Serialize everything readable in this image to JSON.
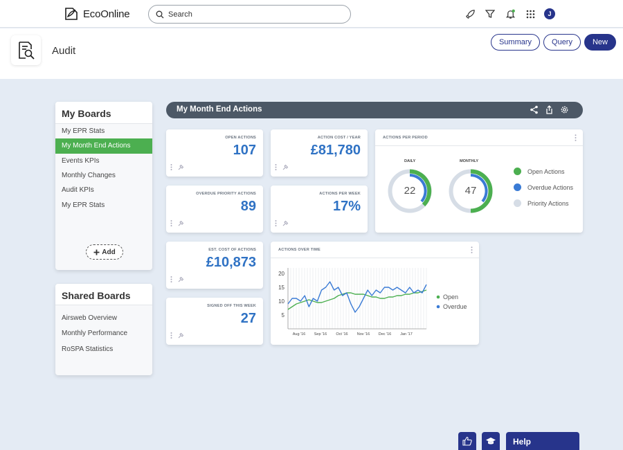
{
  "app": {
    "brand": "EcoOnline"
  },
  "search": {
    "placeholder": "Search"
  },
  "user": {
    "initial": "J"
  },
  "page": {
    "title": "Audit"
  },
  "header_buttons": {
    "summary": "Summary",
    "query": "Query",
    "new": "New"
  },
  "my_boards": {
    "title": "My Boards",
    "items": [
      {
        "label": "My EPR Stats",
        "active": false
      },
      {
        "label": "My Month End Actions",
        "active": true
      },
      {
        "label": "Events KPIs",
        "active": false
      },
      {
        "label": "Monthly Changes",
        "active": false
      },
      {
        "label": "Audit KPIs",
        "active": false
      },
      {
        "label": "My EPR Stats",
        "active": false
      }
    ],
    "add_label": "Add"
  },
  "shared_boards": {
    "title": "Shared Boards",
    "items": [
      {
        "label": "Airsweb Overview"
      },
      {
        "label": "Monthly Performance"
      },
      {
        "label": "RoSPA Statistics"
      }
    ]
  },
  "dashboard": {
    "title": "My Month End Actions"
  },
  "tiles": [
    {
      "label": "Open Actions",
      "value": "107"
    },
    {
      "label": "Action Cost / Year",
      "value": "£81,780"
    },
    {
      "label": "Overdue Priority Actions",
      "value": "89"
    },
    {
      "label": "Actions Per Week",
      "value": "17%"
    },
    {
      "label": "Est. Cost of Actions",
      "value": "£10,873"
    },
    {
      "label": "Signed Off This Week",
      "value": "27"
    }
  ],
  "actions_per_period": {
    "title": "Actions Per Period",
    "daily": {
      "label": "Daily",
      "value": "22"
    },
    "monthly": {
      "label": "Monthly",
      "value": "47"
    },
    "legend": [
      {
        "label": "Open Actions",
        "color": "#4caf50"
      },
      {
        "label": "Overdue Actions",
        "color": "#3a7bd5"
      },
      {
        "label": "Priority Actions",
        "color": "#d6dde6"
      }
    ]
  },
  "colors": {
    "accent": "#27348b",
    "green": "#4caf50",
    "blue": "#2f72c4",
    "bar": "#4c5866"
  },
  "chart_data": {
    "type": "line",
    "title": "Actions Over Time",
    "xlabel": "",
    "ylabel": "",
    "ylim": [
      0,
      22
    ],
    "yticks": [
      5,
      10,
      15,
      20
    ],
    "xtick_labels": [
      "Aug '16",
      "Sep '16",
      "Oct '16",
      "Nov '16",
      "Dec '16",
      "Jan '17"
    ],
    "x_range": [
      0,
      33
    ],
    "legend_position": "right",
    "series": [
      {
        "name": "Open",
        "color": "#4caf50",
        "x": [
          0,
          1,
          2,
          3,
          4,
          5,
          6,
          7,
          8,
          9,
          10,
          11,
          12,
          13,
          14,
          15,
          16,
          17,
          18,
          19,
          20,
          21,
          22,
          23,
          24,
          25,
          26,
          27,
          28,
          29,
          30,
          31,
          32,
          33
        ],
        "values": [
          7,
          8,
          9,
          9.5,
          10,
          10.5,
          10,
          9.5,
          9.5,
          10,
          10.5,
          11,
          12,
          12.5,
          13,
          13,
          12.5,
          12.5,
          12.5,
          12,
          11.5,
          11.5,
          11,
          11,
          11.5,
          11.5,
          12,
          12,
          12.5,
          12.5,
          13,
          13,
          13.5,
          14
        ]
      },
      {
        "name": "Overdue",
        "color": "#3a7bd5",
        "x": [
          0,
          1,
          2,
          3,
          4,
          5,
          6,
          7,
          8,
          9,
          10,
          11,
          12,
          13,
          14,
          15,
          16,
          17,
          18,
          19,
          20,
          21,
          22,
          23,
          24,
          25,
          26,
          27,
          28,
          29,
          30,
          31,
          32,
          33
        ],
        "values": [
          9,
          11,
          11,
          10,
          12,
          8,
          11,
          10,
          14,
          15,
          17,
          14,
          15,
          12,
          13,
          9,
          6,
          8,
          11,
          14,
          12,
          14,
          13,
          15,
          15,
          14,
          15,
          14,
          13,
          15,
          13,
          14,
          13,
          16
        ]
      }
    ]
  }
}
